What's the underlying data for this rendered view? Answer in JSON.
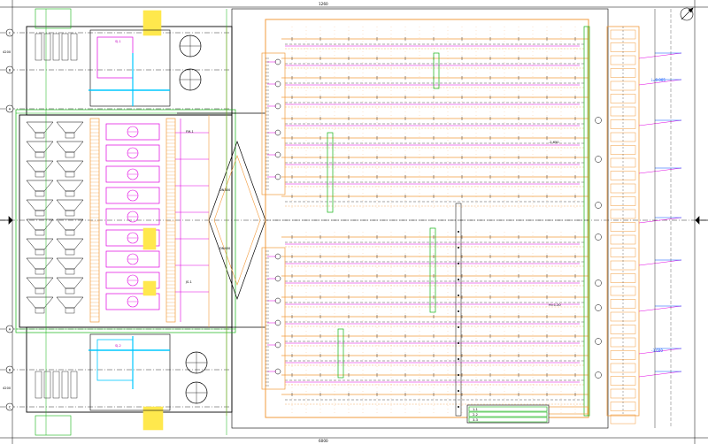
{
  "colors": {
    "background": "#ffffff",
    "orange": "#f29b3c",
    "magenta": "#e000e0",
    "green": "#14b414",
    "cyan": "#00c8ff",
    "yellow": "#ffe84d",
    "black": "#000000",
    "blue": "#0050ff"
  },
  "grid_bubbles": [
    {
      "id": "g1",
      "label": "C"
    },
    {
      "id": "g2",
      "label": "B"
    },
    {
      "id": "g3",
      "label": "A"
    },
    {
      "id": "g4",
      "label": "A"
    },
    {
      "id": "g5",
      "label": "B"
    },
    {
      "id": "g6",
      "label": "C"
    }
  ],
  "small_labels": {
    "dim_top": "1260",
    "dim_bottom": "6000",
    "dim_left_upper": "4200",
    "dim_left_lower": "4200",
    "tank_tag_a": "SJ-1",
    "tank_tag_b": "SJ-2",
    "pipe_tag": "DN300",
    "pipe_tag_2": "DN400",
    "valve_tag": "FM-1",
    "box_tag": "JS-1",
    "note_a": "i=0.005",
    "note_b": "-3.600",
    "note_c": "-2.650",
    "note_d": "H=1.20"
  },
  "title_block": {
    "rows": [
      "1-1",
      "2-2",
      "3-3"
    ]
  }
}
